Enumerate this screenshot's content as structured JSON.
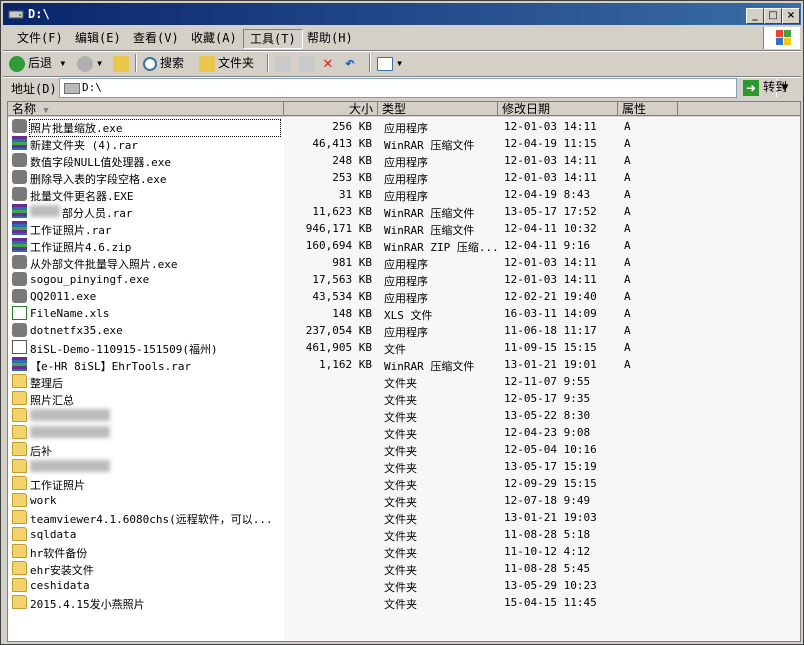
{
  "window": {
    "title": "D:\\"
  },
  "menu": [
    {
      "label": "文件(F)"
    },
    {
      "label": "编辑(E)"
    },
    {
      "label": "查看(V)"
    },
    {
      "label": "收藏(A)"
    },
    {
      "label": "工具(T)"
    },
    {
      "label": "帮助(H)"
    }
  ],
  "toolbar": {
    "back": "后退",
    "search": "搜索",
    "folders": "文件夹"
  },
  "address": {
    "label": "地址(D)",
    "value": "D:\\",
    "go": "转到"
  },
  "columns": {
    "name": "名称",
    "size": "大小",
    "type": "类型",
    "date": "修改日期",
    "attr": "属性"
  },
  "files": [
    {
      "name": "照片批量缩放.exe",
      "size": "256 KB",
      "type": "应用程序",
      "date": "12-01-03 14:11",
      "attr": "A",
      "icon": "exe-icon"
    },
    {
      "name": "新建文件夹 (4).rar",
      "size": "46,413 KB",
      "type": "WinRAR 压缩文件",
      "date": "12-04-19 11:15",
      "attr": "A",
      "icon": "rar-icon"
    },
    {
      "name": "数值字段NULL值处理器.exe",
      "size": "248 KB",
      "type": "应用程序",
      "date": "12-01-03 14:11",
      "attr": "A",
      "icon": "exe-icon"
    },
    {
      "name": "删除导入表的字段空格.exe",
      "size": "253 KB",
      "type": "应用程序",
      "date": "12-01-03 14:11",
      "attr": "A",
      "icon": "exe-icon"
    },
    {
      "name": "批量文件更名器.EXE",
      "size": "31 KB",
      "type": "应用程序",
      "date": "12-04-19 8:43",
      "attr": "A",
      "icon": "exe-icon"
    },
    {
      "name": "部分人员.rar",
      "size": "11,623 KB",
      "type": "WinRAR 压缩文件",
      "date": "13-05-17 17:52",
      "attr": "A",
      "icon": "rar-icon"
    },
    {
      "name": "工作证照片.rar",
      "size": "946,171 KB",
      "type": "WinRAR 压缩文件",
      "date": "12-04-11 10:32",
      "attr": "A",
      "icon": "rar-icon"
    },
    {
      "name": "工作证照片4.6.zip",
      "size": "160,694 KB",
      "type": "WinRAR ZIP 压缩...",
      "date": "12-04-11 9:16",
      "attr": "A",
      "icon": "rar-icon"
    },
    {
      "name": "从外部文件批量导入照片.exe",
      "size": "981 KB",
      "type": "应用程序",
      "date": "12-01-03 14:11",
      "attr": "A",
      "icon": "exe-icon"
    },
    {
      "name": "sogou_pinyingf.exe",
      "size": "17,563 KB",
      "type": "应用程序",
      "date": "12-01-03 14:11",
      "attr": "A",
      "icon": "exe-icon"
    },
    {
      "name": "QQ2011.exe",
      "size": "43,534 KB",
      "type": "应用程序",
      "date": "12-02-21 19:40",
      "attr": "A",
      "icon": "exe-icon"
    },
    {
      "name": "FileName.xls",
      "size": "148 KB",
      "type": "XLS 文件",
      "date": "16-03-11 14:09",
      "attr": "A",
      "icon": "xls-icon"
    },
    {
      "name": "dotnetfx35.exe",
      "size": "237,054 KB",
      "type": "应用程序",
      "date": "11-06-18 11:17",
      "attr": "A",
      "icon": "exe-icon"
    },
    {
      "name": "8iSL-Demo-110915-151509(福州)",
      "size": "461,905 KB",
      "type": "文件",
      "date": "11-09-15 15:15",
      "attr": "A",
      "icon": "file-icon"
    },
    {
      "name": "【e-HR 8iSL】EhrTools.rar",
      "size": "1,162 KB",
      "type": "WinRAR 压缩文件",
      "date": "13-01-21 19:01",
      "attr": "A",
      "icon": "rar-icon"
    },
    {
      "name": "整理后",
      "size": "",
      "type": "文件夹",
      "date": "12-11-07 9:55",
      "attr": "",
      "icon": "folder-icon"
    },
    {
      "name": "照片汇总",
      "size": "",
      "type": "文件夹",
      "date": "12-05-17 9:35",
      "attr": "",
      "icon": "folder-icon"
    },
    {
      "name": "",
      "size": "",
      "type": "文件夹",
      "date": "13-05-22 8:30",
      "attr": "",
      "icon": "folder-icon"
    },
    {
      "name": "",
      "size": "",
      "type": "文件夹",
      "date": "12-04-23 9:08",
      "attr": "",
      "icon": "folder-icon"
    },
    {
      "name": "后补",
      "size": "",
      "type": "文件夹",
      "date": "12-05-04 10:16",
      "attr": "",
      "icon": "folder-icon"
    },
    {
      "name": "",
      "size": "",
      "type": "文件夹",
      "date": "13-05-17 15:19",
      "attr": "",
      "icon": "folder-icon"
    },
    {
      "name": "工作证照片",
      "size": "",
      "type": "文件夹",
      "date": "12-09-29 15:15",
      "attr": "",
      "icon": "folder-icon"
    },
    {
      "name": "work",
      "size": "",
      "type": "文件夹",
      "date": "12-07-18 9:49",
      "attr": "",
      "icon": "folder-icon"
    },
    {
      "name": "teamviewer4.1.6080chs(远程软件，可以...",
      "size": "",
      "type": "文件夹",
      "date": "13-01-21 19:03",
      "attr": "",
      "icon": "folder-icon"
    },
    {
      "name": "sqldata",
      "size": "",
      "type": "文件夹",
      "date": "11-08-28 5:18",
      "attr": "",
      "icon": "folder-icon"
    },
    {
      "name": "hr软件备份",
      "size": "",
      "type": "文件夹",
      "date": "11-10-12 4:12",
      "attr": "",
      "icon": "folder-icon"
    },
    {
      "name": "ehr安装文件",
      "size": "",
      "type": "文件夹",
      "date": "11-08-28 5:45",
      "attr": "",
      "icon": "folder-icon"
    },
    {
      "name": "ceshidata",
      "size": "",
      "type": "文件夹",
      "date": "13-05-29 10:23",
      "attr": "",
      "icon": "folder-icon"
    },
    {
      "name": "2015.4.15发小燕照片",
      "size": "",
      "type": "文件夹",
      "date": "15-04-15 11:45",
      "attr": "",
      "icon": "folder-icon"
    }
  ]
}
